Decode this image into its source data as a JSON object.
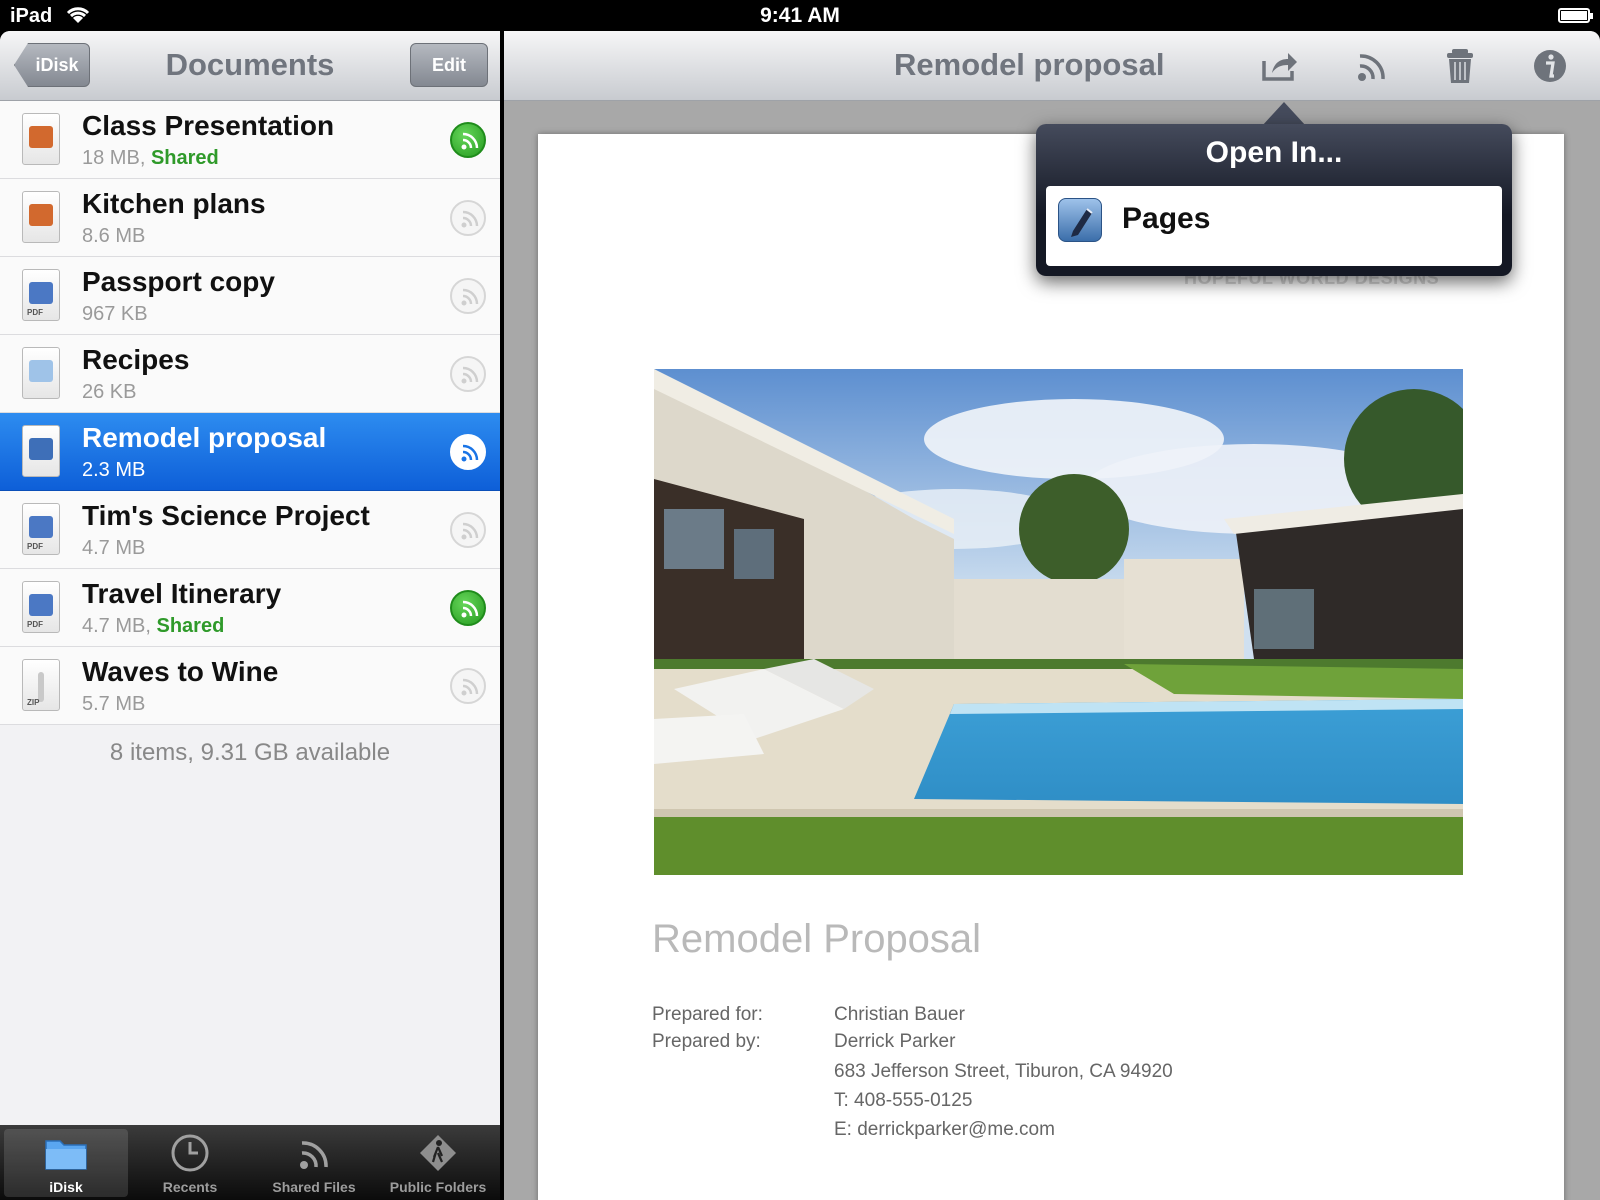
{
  "status_bar": {
    "carrier": "iPad",
    "time": "9:41 AM"
  },
  "left_pane": {
    "back_label": "iDisk",
    "title": "Documents",
    "edit_label": "Edit",
    "files": [
      {
        "name": "Class Presentation",
        "size": "18 MB",
        "shared": "Shared",
        "type": "keynote",
        "share_on": true
      },
      {
        "name": "Kitchen plans",
        "size": "8.6 MB",
        "shared": "",
        "type": "keynote",
        "share_on": false
      },
      {
        "name": "Passport copy",
        "size": "967 KB",
        "shared": "",
        "type": "pdf",
        "share_on": false
      },
      {
        "name": "Recipes",
        "size": "26 KB",
        "shared": "",
        "type": "text",
        "share_on": false
      },
      {
        "name": "Remodel proposal",
        "size": "2.3 MB",
        "shared": "",
        "type": "pages",
        "share_on": false
      },
      {
        "name": "Tim's Science Project",
        "size": "4.7 MB",
        "shared": "",
        "type": "pdf",
        "share_on": false
      },
      {
        "name": "Travel Itinerary",
        "size": "4.7 MB",
        "shared": "Shared",
        "type": "pdf",
        "share_on": true
      },
      {
        "name": "Waves to Wine",
        "size": "5.7 MB",
        "shared": "",
        "type": "zip",
        "share_on": false
      }
    ],
    "footer": "8 items, 9.31 GB available",
    "tabs": [
      {
        "label": "iDisk",
        "icon": "folder-icon"
      },
      {
        "label": "Recents",
        "icon": "clock-icon"
      },
      {
        "label": "Shared Files",
        "icon": "broadcast-icon"
      },
      {
        "label": "Public Folders",
        "icon": "walker-icon"
      }
    ]
  },
  "right_pane": {
    "title": "Remodel proposal",
    "toolbar_icons": [
      "share-icon",
      "broadcast-icon",
      "trash-icon",
      "info-icon"
    ],
    "document": {
      "company": "HOPEFUL WORLD DESIGNS",
      "title": "Remodel Proposal",
      "prepared_for_label": "Prepared for:",
      "prepared_for": "Christian Bauer",
      "prepared_by_label": "Prepared by:",
      "prepared_by": "Derrick Parker",
      "address": "683 Jefferson Street, Tiburon, CA 94920",
      "phone": "T: 408-555-0125",
      "email": "E: derrickparker@me.com"
    },
    "popover": {
      "title": "Open In...",
      "items": [
        {
          "label": "Pages",
          "icon": "pages-app-icon"
        }
      ]
    }
  },
  "colors": {
    "selection": "#1a74e6",
    "shared_green": "#2f9a2a",
    "nav_text": "#70757e"
  }
}
